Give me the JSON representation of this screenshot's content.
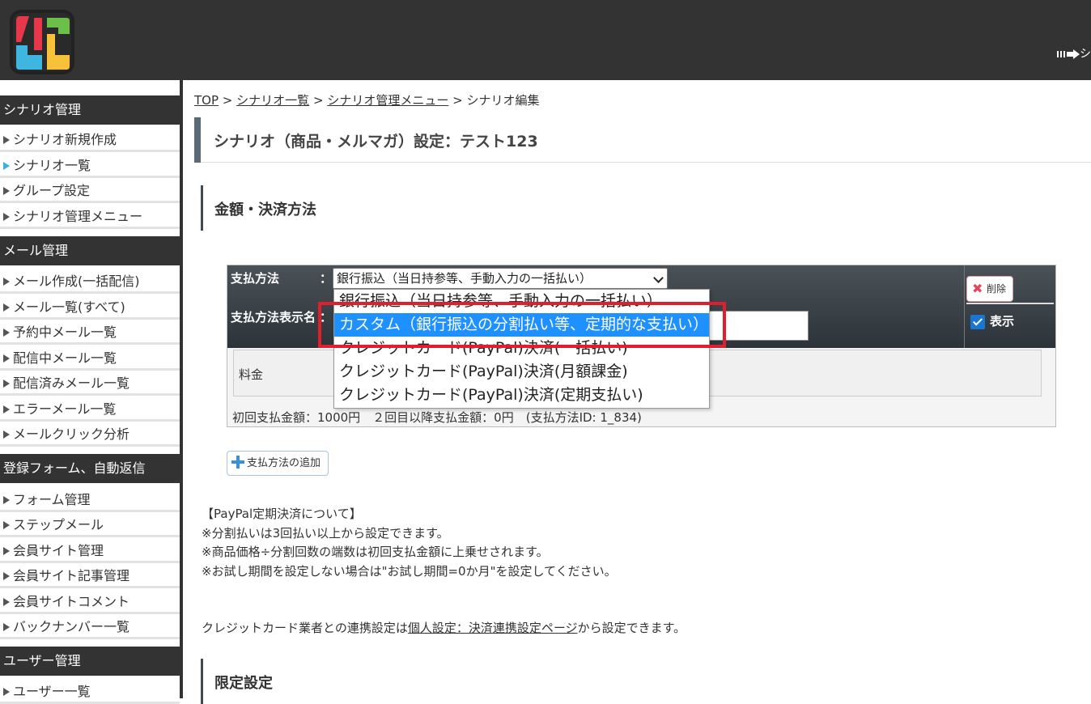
{
  "header": {
    "top_link": "シ"
  },
  "sidebar": {
    "sections": [
      {
        "title": "シナリオ管理",
        "items": [
          "シナリオ新規作成",
          "シナリオ一覧",
          "グループ設定",
          "シナリオ管理メニュー"
        ]
      },
      {
        "title": "メール管理",
        "items": [
          "メール作成(一括配信)",
          "メール一覧(すべて)",
          "予約中メール一覧",
          "配信中メール一覧",
          "配信済みメール一覧",
          "エラーメール一覧",
          "メールクリック分析"
        ]
      },
      {
        "title": "登録フォーム、自動返信",
        "items": [
          "フォーム管理",
          "ステップメール",
          "会員サイト管理",
          "会員サイト記事管理",
          "会員サイトコメント",
          "バックナンバー一覧"
        ]
      },
      {
        "title": "ユーザー管理",
        "items": [
          "ユーザー一覧"
        ]
      }
    ],
    "active_item": "シナリオ一覧"
  },
  "breadcrumb": {
    "items": [
      "TOP",
      "シナリオ一覧",
      "シナリオ管理メニュー",
      "シナリオ編集"
    ],
    "separator": ">"
  },
  "page_title": "シナリオ（商品・メルマガ）設定：テスト123",
  "section_price": "金額・決済方法",
  "payment": {
    "method_label": "支払方法",
    "colon": "：",
    "display_name_label": "支払方法表示名",
    "selected": "銀行振込（当日持参等、手動入力の一括払い）",
    "options": [
      "銀行振込（当日持参等、手動入力の一括払い）",
      "カスタム（銀行振込の分割払い等、定期的な支払い）",
      "クレジットカード(PayPal)決済(一括払い)",
      "クレジットカード(PayPal)決済(月額課金)",
      "クレジットカード(PayPal)決済(定期支払い)"
    ],
    "highlighted_index": 1,
    "delete_label": "削除",
    "show_label": "表示",
    "show_checked": true,
    "fee_label": "料金",
    "summary": "初回支払金額：1000円　２回目以降支払金額：0円　(支払方法ID: 1_834)"
  },
  "add_method_label": "支払方法の追加",
  "notes": [
    "【PayPal定期決済について】",
    "※分割払いは3回払い以上から設定できます。",
    "※商品価格÷分割回数の端数は初回支払金額に上乗せされます。",
    "※お試し期間を設定しない場合は\"お試し期間=0か月\"を設定してください。"
  ],
  "cc_line": {
    "prefix": "クレジットカード業者との連携設定は",
    "link": "個人設定：決済連携設定ページ",
    "suffix": "から設定できます。"
  },
  "section_limit": "限定設定",
  "colors": {
    "topbar": "#333333",
    "highlight": "#1e90ff",
    "annotation_red": "#e01e2e"
  }
}
